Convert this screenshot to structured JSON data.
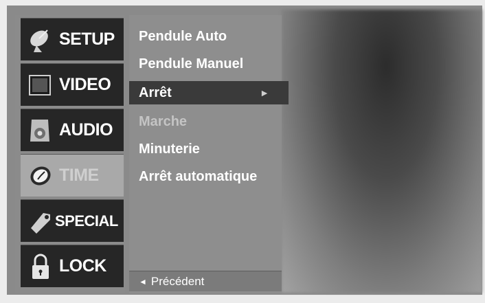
{
  "sidebar": {
    "items": [
      {
        "label": "SETUP",
        "icon": "satellite-dish-icon",
        "state": "normal"
      },
      {
        "label": "VIDEO",
        "icon": "screen-icon",
        "state": "normal"
      },
      {
        "label": "AUDIO",
        "icon": "speaker-icon",
        "state": "normal"
      },
      {
        "label": "TIME",
        "icon": "clock-icon",
        "state": "active"
      },
      {
        "label": "SPECIAL",
        "icon": "tag-icon",
        "state": "normal"
      },
      {
        "label": "LOCK",
        "icon": "padlock-icon",
        "state": "normal"
      }
    ]
  },
  "submenu": {
    "items": [
      {
        "label": "Pendule Auto",
        "state": "normal"
      },
      {
        "label": "Pendule Manuel",
        "state": "normal"
      },
      {
        "label": "Arrêt",
        "state": "selected",
        "arrow": "►"
      },
      {
        "label": "Marche",
        "state": "disabled"
      },
      {
        "label": "Minuterie",
        "state": "normal"
      },
      {
        "label": "Arrêt automatique",
        "state": "normal"
      }
    ],
    "back_label": "Précédent",
    "back_arrow": "◄"
  },
  "colors": {
    "panel": "#8e8e8e",
    "tab_dark": "#262626",
    "tab_active": "#a9a9a9",
    "selected_row": "#3a3a3a"
  }
}
